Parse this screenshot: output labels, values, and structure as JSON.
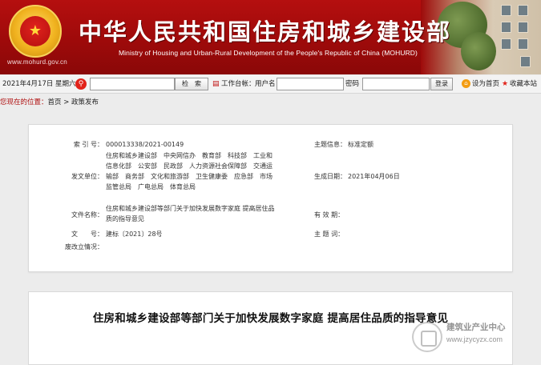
{
  "header": {
    "site_url": "www.mohurd.gov.cn",
    "title_cn": "中华人民共和国住房和城乡建设部",
    "title_en": "Ministry of Housing and Urban-Rural Development of the People's Republic of China (MOHURD)"
  },
  "toolbar": {
    "date": "2021年4月17日 星期六",
    "search_value": "",
    "search_button": "检　索",
    "workbench_label": "工作台帐：",
    "username_label": "用户名",
    "password_label": "密码",
    "login_button": "登录",
    "set_homepage": "设为首页",
    "add_favorite": "收藏本站"
  },
  "breadcrumb": {
    "location_label": "您现在的位置：",
    "path": "首页 > 政策发布"
  },
  "info": {
    "index_label": "索 引 号：",
    "index_value": "000013338/2021-00149",
    "category_label": "主题信息：",
    "category_value": "标准定额",
    "issuer_label": "发文单位：",
    "issuer_value": "住房和城乡建设部　中央网信办　教育部　科技部　工业和信息化部　公安部　民政部　人力资源社会保障部　交通运输部　商务部　文化和旅游部　卫生健康委　应急部　市场监管总局　广电总局　体育总局",
    "date_label": "生成日期：",
    "date_value": "2021年04月06日",
    "filename_label": "文件名称：",
    "filename_value": "住房和城乡建设部等部门关于加快发展数字家庭 提高居住品质的指导意见",
    "validity_label": "有 效 期：",
    "validity_value": "",
    "docno_label": "文　　号：",
    "docno_value": "建标〔2021〕28号",
    "subject_label": "主 题 词：",
    "subject_value": "",
    "abolish_label": "废改立情况："
  },
  "article": {
    "title": "住房和城乡建设部等部门关于加快发展数字家庭 提高居住品质的指导意见"
  },
  "watermark": {
    "cn": "建筑业产业中心",
    "url": "www.jzycyzx.com"
  },
  "colors": {
    "banner_red": "#9e0a0a",
    "location_red": "#b01010",
    "search_icon": "#e2231a",
    "home_icon": "#f39c12"
  }
}
